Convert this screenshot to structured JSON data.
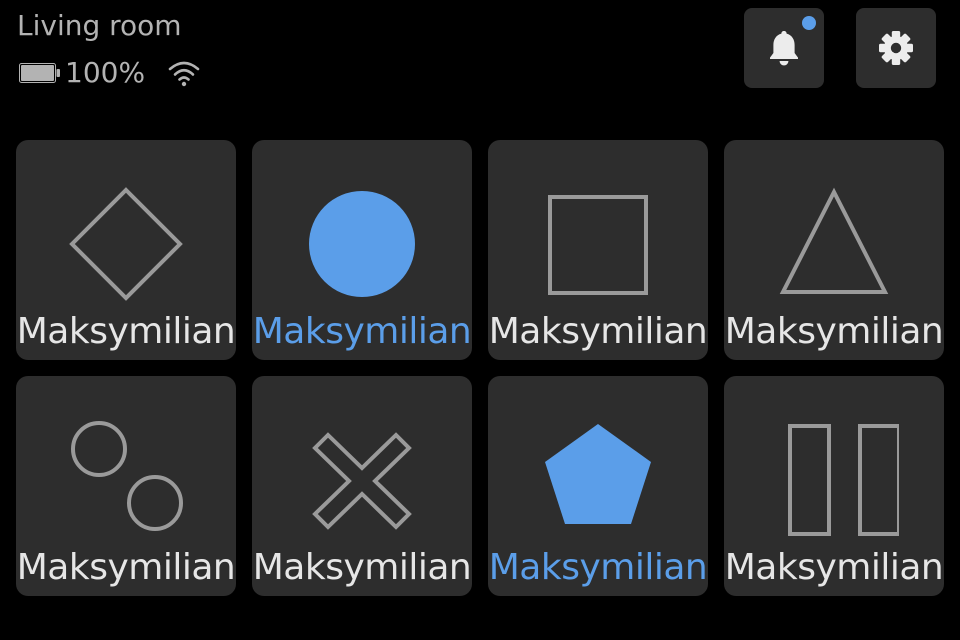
{
  "header": {
    "room_title": "Living room",
    "battery_level": "100%",
    "battery_fraction": 1.0
  },
  "colors": {
    "background": "#000000",
    "tile": "#2d2d2d",
    "text": "#e6e6e6",
    "muted_text": "#b3b3b3",
    "outline": "#9a9a9a",
    "accent": "#5b9ee9"
  },
  "actions": {
    "notifications": {
      "icon": "bell-icon",
      "has_unread": true
    },
    "settings": {
      "icon": "gear-icon"
    }
  },
  "tiles": [
    {
      "label": "Maksymilian",
      "icon": "diamond",
      "active": false
    },
    {
      "label": "Maksymilian",
      "icon": "circle",
      "active": true
    },
    {
      "label": "Maksymilian",
      "icon": "square",
      "active": false
    },
    {
      "label": "Maksymilian",
      "icon": "triangle",
      "active": false
    },
    {
      "label": "Maksymilian",
      "icon": "two-circles",
      "active": false
    },
    {
      "label": "Maksymilian",
      "icon": "cross",
      "active": false
    },
    {
      "label": "Maksymilian",
      "icon": "pentagon",
      "active": true
    },
    {
      "label": "Maksymilian",
      "icon": "pause",
      "active": false
    }
  ]
}
